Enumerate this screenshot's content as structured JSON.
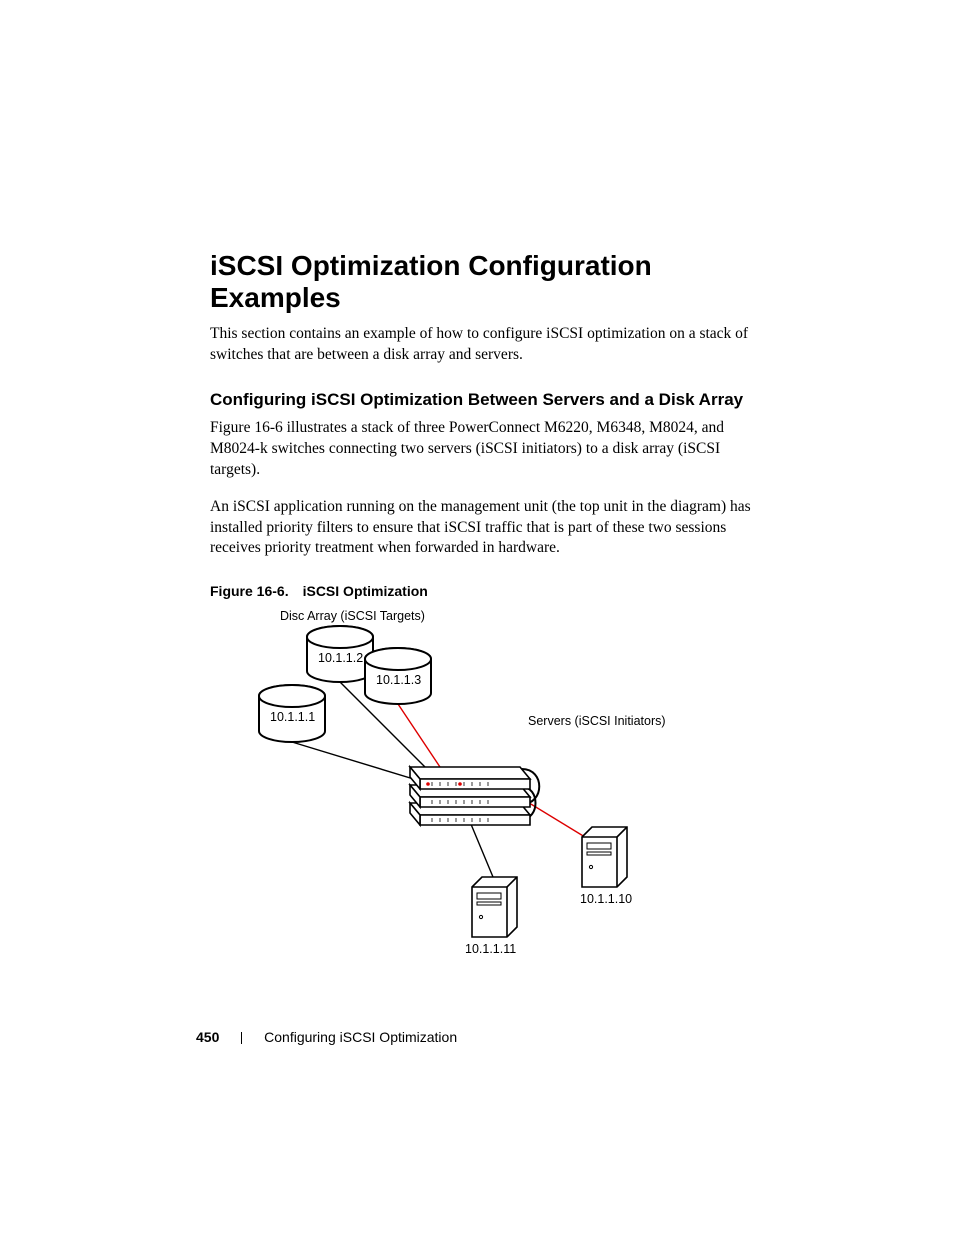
{
  "heading": "iSCSI Optimization Configuration Examples",
  "intro": "This section contains an example of how to configure iSCSI optimization on a stack of switches that are between a disk array and servers.",
  "subheading": "Configuring iSCSI Optimization Between Servers and a Disk Array",
  "para1": "Figure 16-6 illustrates a stack of three PowerConnect M6220, M6348, M8024, and M8024-k switches connecting two servers (iSCSI initiators) to a disk array (iSCSI targets).",
  "para2": "An iSCSI application running on the management unit (the top unit in the diagram) has installed priority filters to ensure that iSCSI traffic that is part of these two sessions receives priority treatment when forwarded in hardware.",
  "figure": {
    "label_prefix": "Figure 16-6.",
    "label_title": "iSCSI Optimization",
    "targets_label": "Disc Array (iSCSI Targets)",
    "initiators_label": "Servers (iSCSI Initiators)",
    "disk_ips": [
      "10.1.1.1",
      "10.1.1.2",
      "10.1.1.3"
    ],
    "server_ips": [
      "10.1.1.10",
      "10.1.1.11"
    ]
  },
  "footer": {
    "page_number": "450",
    "section": "Configuring iSCSI Optimization"
  }
}
